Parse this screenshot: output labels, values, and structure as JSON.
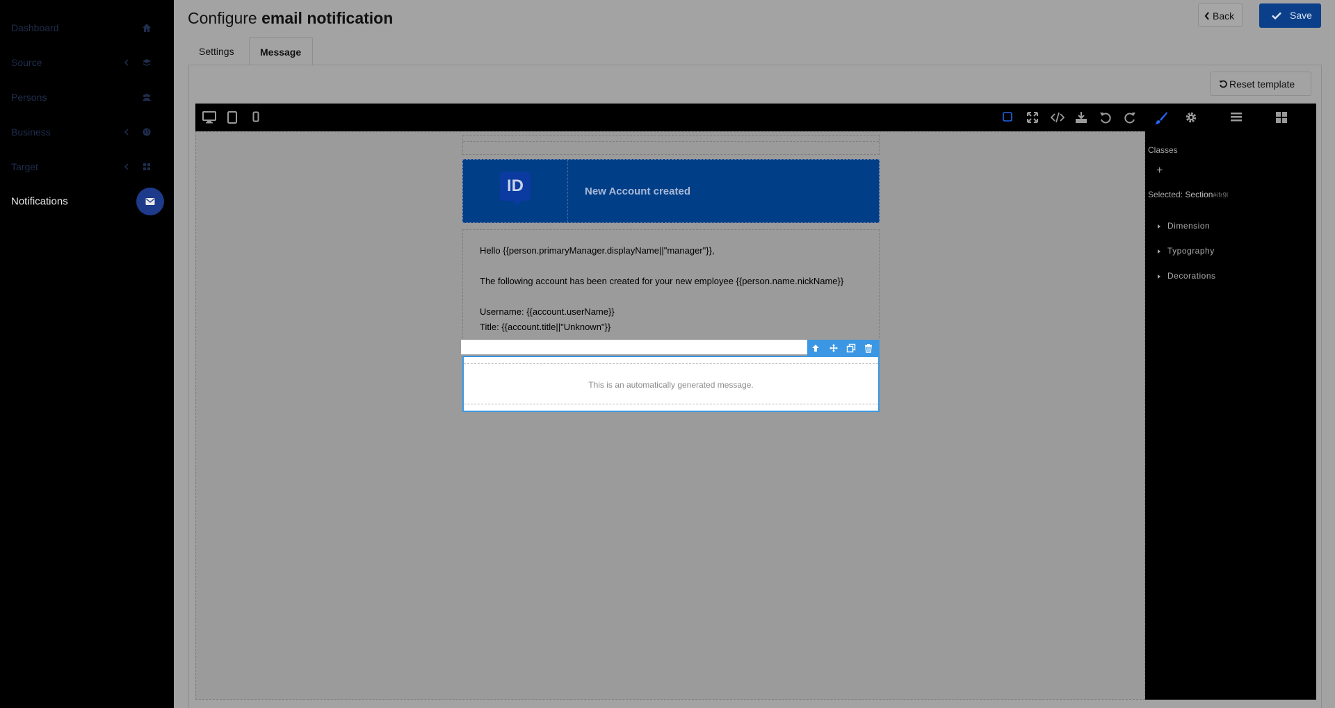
{
  "sidebar": {
    "items": [
      {
        "label": "Dashboard",
        "icon": "home-icon",
        "has_chevron": false
      },
      {
        "label": "Source",
        "icon": "layers-icon",
        "has_chevron": true
      },
      {
        "label": "Persons",
        "icon": "users-icon",
        "has_chevron": false
      },
      {
        "label": "Business",
        "icon": "globe-icon",
        "has_chevron": true
      },
      {
        "label": "Target",
        "icon": "grid-icon",
        "has_chevron": true
      },
      {
        "label": "Notifications",
        "icon": "envelope-icon",
        "has_chevron": false,
        "active": true
      }
    ]
  },
  "header": {
    "title_prefix": "Configure",
    "title_bold": "email notification",
    "back_label": "Back",
    "save_label": "Save"
  },
  "tabs": {
    "settings": "Settings",
    "message": "Message",
    "active": "Message"
  },
  "reset_label": "Reset template",
  "editor": {
    "device_icons": [
      "desktop-icon",
      "tablet-icon",
      "mobile-icon"
    ],
    "toolbar_icons": [
      "outline-icon",
      "fullscreen-icon",
      "code-icon",
      "download-icon",
      "undo-icon",
      "redo-icon",
      "style-manager-icon",
      "settings-icon",
      "layers-icon",
      "blocks-icon"
    ],
    "panel": {
      "classes_label": "Classes",
      "add_label": "+",
      "selected_prefix": "Selected:",
      "selected_name": "Section",
      "selected_id": "#ifr9l",
      "properties": [
        "Dimension",
        "Typography",
        "Decorations"
      ]
    }
  },
  "email": {
    "logo_text": "ID",
    "header_title": "New Account created",
    "body_lines": [
      "Hello {{person.primaryManager.displayName||\"manager\"}},",
      "The following account has been created for your new employee {{person.name.nickName}}",
      "Username: {{account.userName}}",
      "Title: {{account.title||\"Unknown\"}}"
    ],
    "footer_text": "This is an automatically generated message."
  },
  "colors": {
    "sidebar_bg": "#000000",
    "accent": "#0b3f8a",
    "email_header": "#003f88",
    "selection": "#3b97e3",
    "active_icon": "#2563eb"
  }
}
